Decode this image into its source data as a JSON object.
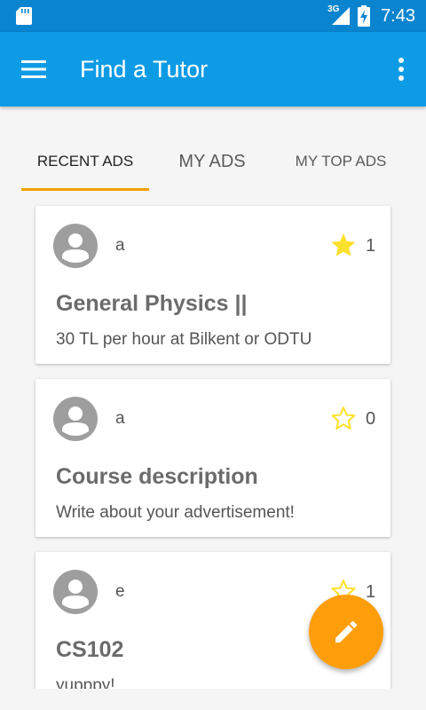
{
  "status_bar": {
    "network": "3G",
    "time": "7:43"
  },
  "app_bar": {
    "title": "Find a Tutor",
    "menu_icon": "hamburger-menu-icon",
    "more_icon": "more-vert-icon",
    "color": "#0d9be5"
  },
  "tabs": [
    {
      "label": "RECENT ADS",
      "active": true
    },
    {
      "label": "MY ADS",
      "active": false
    },
    {
      "label": "MY TOP ADS",
      "active": false
    }
  ],
  "accent_color": "#f5a000",
  "cards": [
    {
      "author": "a",
      "starred": true,
      "count": "1",
      "title": "General Physics ||",
      "description": "30 TL per hour at Bilkent or ODTU"
    },
    {
      "author": "a",
      "starred": false,
      "count": "0",
      "title": "Course description",
      "description": "Write about your advertisement!"
    },
    {
      "author": "e",
      "starred": false,
      "count": "1",
      "title": "CS102",
      "description": "yupppy!"
    }
  ],
  "fab": {
    "icon": "pencil-edit-icon",
    "color": "#ff9e0a"
  }
}
